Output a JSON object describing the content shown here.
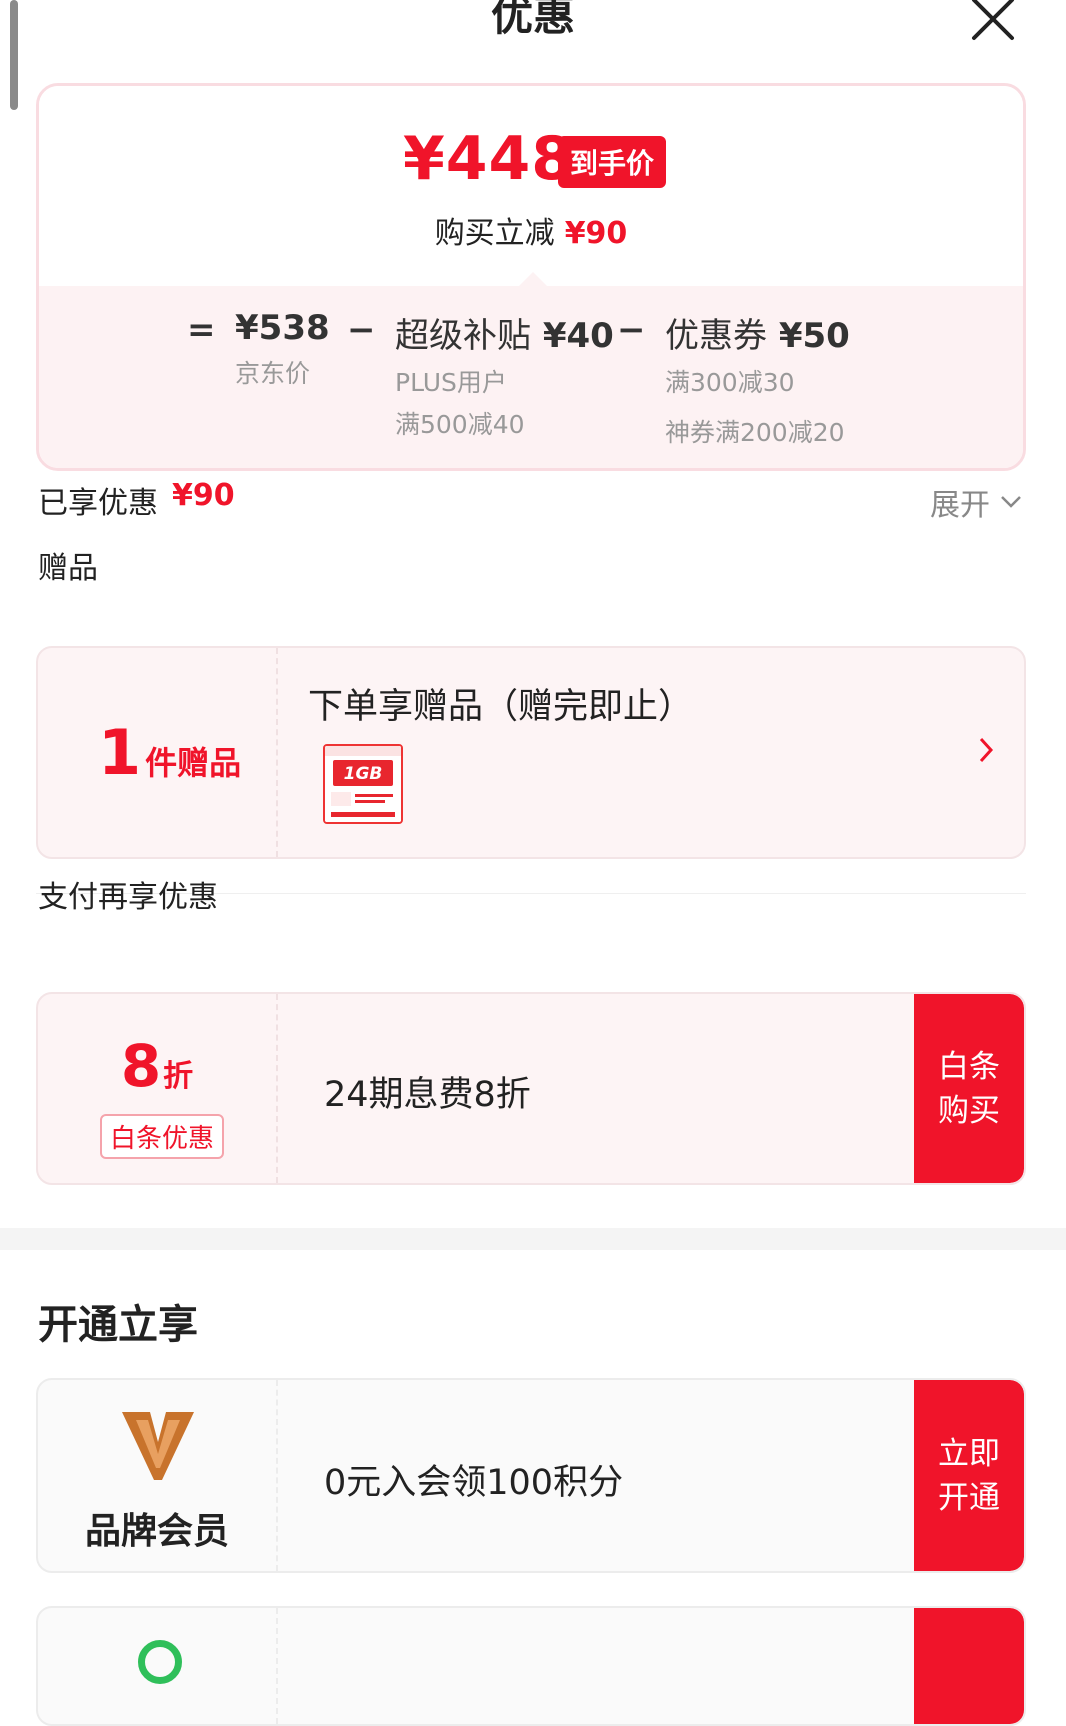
{
  "header": {
    "title": "优惠"
  },
  "price_summary": {
    "final_price": "¥448",
    "final_badge": "到手价",
    "discount_label": "购买立减",
    "discount_amount": "¥90",
    "equals_sign": "=",
    "minus_sign": "−",
    "jd_price": {
      "amount": "¥538",
      "label": "京东价"
    },
    "super_subsidy": {
      "title": "超级补贴",
      "amount": "¥40",
      "sub1": "PLUS用户",
      "sub2": "满500减40"
    },
    "coupon": {
      "title": "优惠券",
      "amount": "¥50",
      "sub1": "满300减30",
      "sub2": "神券满200减20"
    }
  },
  "enjoyed": {
    "label": "已享优惠",
    "amount": "¥90",
    "expand_label": "展开"
  },
  "gift_section": {
    "label": "赠品",
    "count_number": "1",
    "count_unit": "件赠品",
    "title": "下单享赠品（赠完即止）",
    "thumb_text": "1GB"
  },
  "pay_section": {
    "label": "支付再享优惠",
    "rate_number": "8",
    "rate_unit": "折",
    "tag": "白条优惠",
    "description": "24期息费8折",
    "button": "白条购买"
  },
  "open_section": {
    "title": "开通立享",
    "member_name": "品牌会员",
    "description": "0元入会领100积分",
    "button": "立即开通"
  },
  "colors": {
    "accent": "#f0142a",
    "card_bg": "#fdf4f5",
    "member_logo": "#c8732c"
  }
}
